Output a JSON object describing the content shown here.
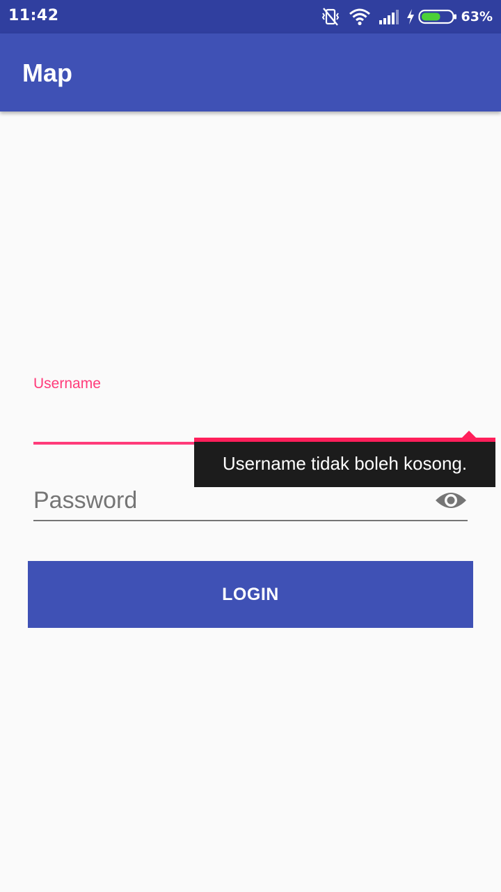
{
  "status_bar": {
    "time": "11:42",
    "battery_percent": "63%",
    "battery_level": 0.63,
    "icons": [
      "vibrate-off-icon",
      "wifi-icon",
      "signal-icon",
      "charging-icon",
      "battery-icon"
    ]
  },
  "app_bar": {
    "title": "Map"
  },
  "form": {
    "username_label": "Username",
    "username_value": "",
    "username_error": "Username tidak boleh kosong.",
    "password_placeholder": "Password",
    "password_value": "",
    "password_toggle_icon": "eye-icon",
    "login_label": "LOGIN"
  },
  "colors": {
    "primary": "#3f51b5",
    "primary_dark": "#303f9f",
    "accent": "#ff3b7a",
    "error": "#ff1f5a",
    "background": "#fafafa"
  }
}
